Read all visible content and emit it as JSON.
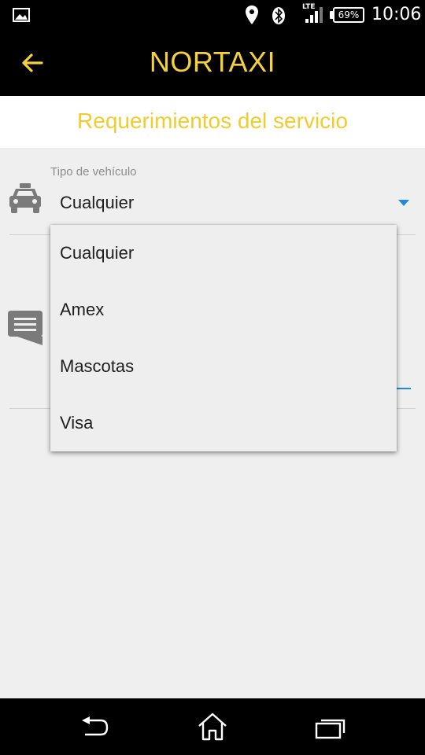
{
  "status_bar": {
    "lte_label": "LTE",
    "battery_percent": "69%",
    "time": "10:06",
    "icons": [
      "picture-icon",
      "location-icon",
      "bluetooth-icon",
      "signal-icon",
      "battery-icon"
    ]
  },
  "app_bar": {
    "title": "NORTAXI",
    "back_icon": "arrow-left-icon"
  },
  "subheader": {
    "title": "Requerimientos del servicio"
  },
  "vehicle_field": {
    "label": "Tipo de vehículo",
    "value": "Cualquier",
    "icon": "taxi-icon"
  },
  "comment_field": {
    "icon": "comment-icon"
  },
  "dropdown": {
    "options": [
      "Cualquier",
      "Amex",
      "Mascotas",
      "Visa"
    ]
  },
  "nav_bar": {
    "icons": [
      "nav-back-icon",
      "nav-home-icon",
      "nav-recent-apps-icon"
    ]
  },
  "colors": {
    "accent_yellow": "#f5d23a",
    "accent_blue": "#1e88e5",
    "background": "#efefef",
    "bar_black": "#000000"
  }
}
